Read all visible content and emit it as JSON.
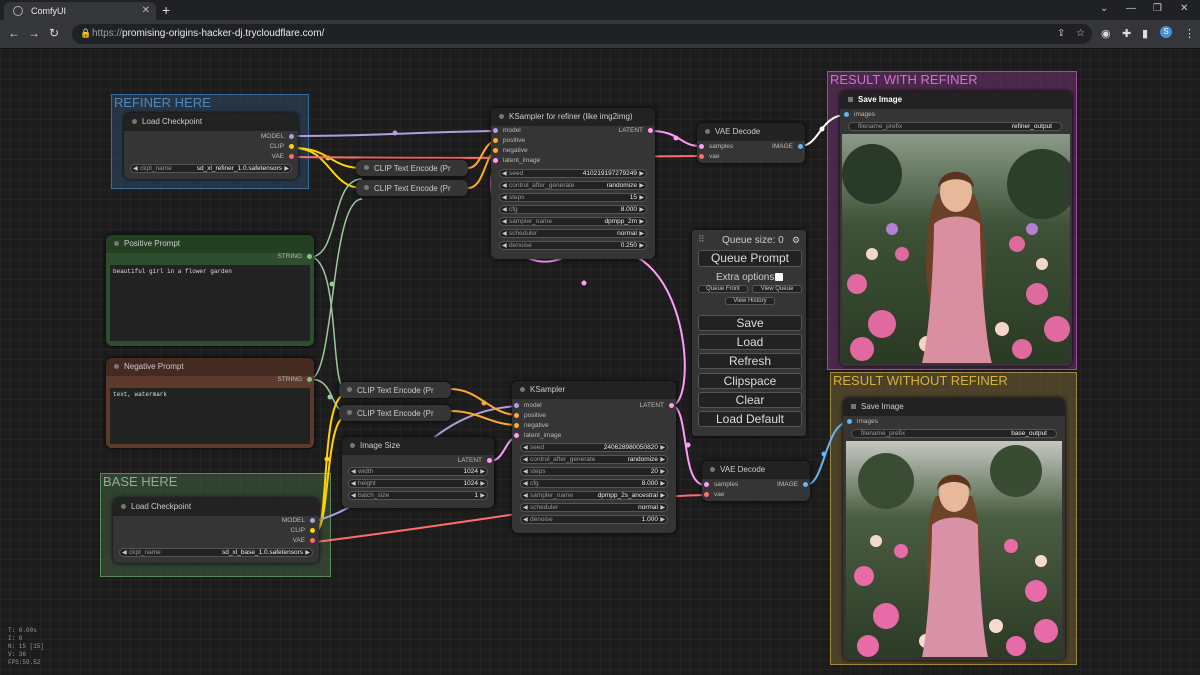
{
  "browser": {
    "tab_title": "ComfyUI",
    "url_protocol": "https://",
    "url_host": "promising-origins-hacker-dj.trycloudflare.com/"
  },
  "groups": {
    "refiner": "REFINER HERE",
    "base": "BASE HERE",
    "result_refiner": "RESULT WITH REFINER",
    "result_base": "RESULT WITHOUT REFINER"
  },
  "nodes": {
    "load_ckpt_refiner": {
      "title": "Load Checkpoint",
      "outputs": [
        "MODEL",
        "CLIP",
        "VAE"
      ],
      "ckpt_label": "ckpt_name",
      "ckpt_value": "sd_xl_refiner_1.0.safetensors"
    },
    "load_ckpt_base": {
      "title": "Load Checkpoint",
      "outputs": [
        "MODEL",
        "CLIP",
        "VAE"
      ],
      "ckpt_label": "ckpt_name",
      "ckpt_value": "sd_xl_base_1.0.safetensors"
    },
    "clip_refiner_1": {
      "title": "CLIP Text Encode (Pr"
    },
    "clip_refiner_2": {
      "title": "CLIP Text Encode (Pr"
    },
    "clip_base_1": {
      "title": "CLIP Text Encode (Pr"
    },
    "clip_base_2": {
      "title": "CLIP Text Encode (Pr"
    },
    "positive_prompt": {
      "title": "Positive Prompt",
      "output": "STRING",
      "text": "beautiful girl in a flower garden"
    },
    "negative_prompt": {
      "title": "Negative Prompt",
      "output": "STRING",
      "text": "text, watermark"
    },
    "ksampler_refiner": {
      "title": "KSampler for refiner (like img2img)",
      "inputs": [
        "model",
        "positive",
        "negative",
        "latent_image"
      ],
      "output": "LATENT",
      "widgets": [
        {
          "label": "seed",
          "value": "410219197279249"
        },
        {
          "label": "control_after_generate",
          "value": "randomize"
        },
        {
          "label": "steps",
          "value": "15"
        },
        {
          "label": "cfg",
          "value": "8.000"
        },
        {
          "label": "sampler_name",
          "value": "dpmpp_2m"
        },
        {
          "label": "scheduler",
          "value": "normal"
        },
        {
          "label": "denoise",
          "value": "0.250"
        }
      ]
    },
    "ksampler_base": {
      "title": "KSampler",
      "inputs": [
        "model",
        "positive",
        "negative",
        "latent_image"
      ],
      "output": "LATENT",
      "widgets": [
        {
          "label": "seed",
          "value": "240628980050820"
        },
        {
          "label": "control_after_generate",
          "value": "randomize"
        },
        {
          "label": "steps",
          "value": "20"
        },
        {
          "label": "cfg",
          "value": "8.000"
        },
        {
          "label": "sampler_name",
          "value": "dpmpp_2s_ancestral"
        },
        {
          "label": "scheduler",
          "value": "normal"
        },
        {
          "label": "denoise",
          "value": "1.000"
        }
      ]
    },
    "image_size": {
      "title": "Image Size",
      "output": "LATENT",
      "widgets": [
        {
          "label": "width",
          "value": "1024"
        },
        {
          "label": "height",
          "value": "1024"
        },
        {
          "label": "batch_size",
          "value": "1"
        }
      ]
    },
    "vae_decode_refiner": {
      "title": "VAE Decode",
      "inputs": [
        "samples",
        "vae"
      ],
      "output": "IMAGE"
    },
    "vae_decode_base": {
      "title": "VAE Decode",
      "inputs": [
        "samples",
        "vae"
      ],
      "output": "IMAGE"
    },
    "save_refiner": {
      "title": "Save Image",
      "input": "images",
      "prefix_label": "filename_prefix",
      "prefix_value": "refiner_output"
    },
    "save_base": {
      "title": "Save Image",
      "input": "images",
      "prefix_label": "filename_prefix",
      "prefix_value": "base_output"
    }
  },
  "queue_panel": {
    "queue_size": "Queue size: 0",
    "queue_prompt": "Queue Prompt",
    "extra_options": "Extra options",
    "queue_front": "Queue Front",
    "view_queue": "View Queue",
    "view_history": "View History",
    "save": "Save",
    "load": "Load",
    "refresh": "Refresh",
    "clipspace": "Clipspace",
    "clear": "Clear",
    "load_default": "Load Default"
  },
  "stats": [
    "T: 0.00s",
    "I: 0",
    "N: 15 [15]",
    "V: 36",
    "FPS:59.52"
  ],
  "colors": {
    "model": "#b39ddb",
    "clip": "#ffd500",
    "vae": "#ff6e6e",
    "conditioning": "#ffa931",
    "latent": "#ff9cf9",
    "image": "#64b5f6",
    "string": "#7ec77e"
  }
}
